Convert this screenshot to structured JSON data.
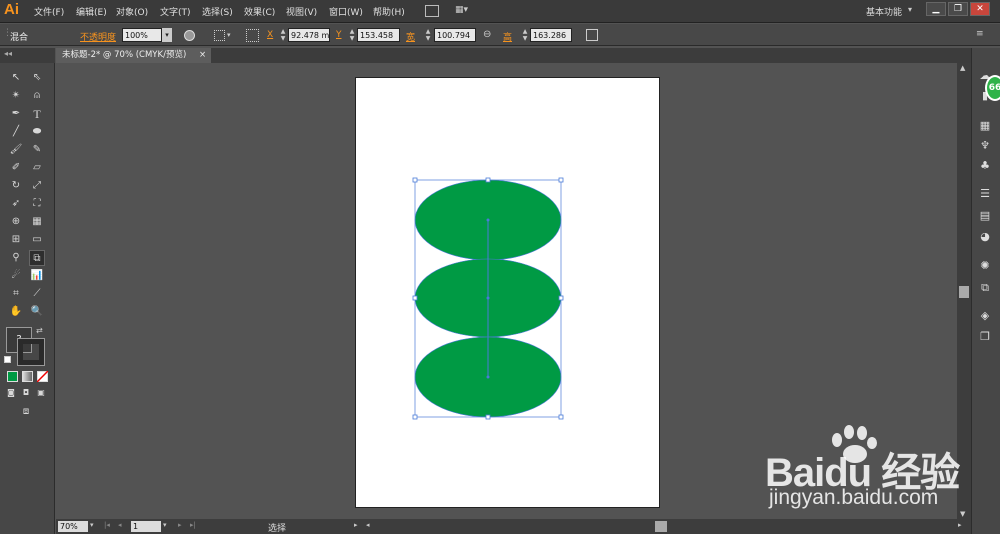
{
  "app": {
    "logo": "Ai",
    "workspace": "基本功能"
  },
  "menu": [
    "文件(F)",
    "编辑(E)",
    "对象(O)",
    "文字(T)",
    "选择(S)",
    "效果(C)",
    "视图(V)",
    "窗口(W)",
    "帮助(H)"
  ],
  "control": {
    "selection_type": "混合",
    "opacity_label": "不透明度",
    "opacity_value": "100%",
    "x_label": "X",
    "x_value": "92.478 m",
    "y_label": "Y",
    "y_value": "153.458",
    "w_label": "宽",
    "w_value": "100.794",
    "h_label": "高",
    "h_value": "163.286"
  },
  "document": {
    "tab_title": "未标题-2* @ 70% (CMYK/预览)",
    "close": "×"
  },
  "status": {
    "zoom": "70%",
    "artboard_number": "1",
    "tool_name": "选择"
  },
  "badge": {
    "value": "66"
  },
  "colors": {
    "ellipse_fill": "#009a44",
    "selection": "#4a7bd8",
    "fill_swatch": "#009a44"
  },
  "watermark": {
    "brand": "Baidu 经验",
    "url": "jingyan.baidu.com"
  }
}
